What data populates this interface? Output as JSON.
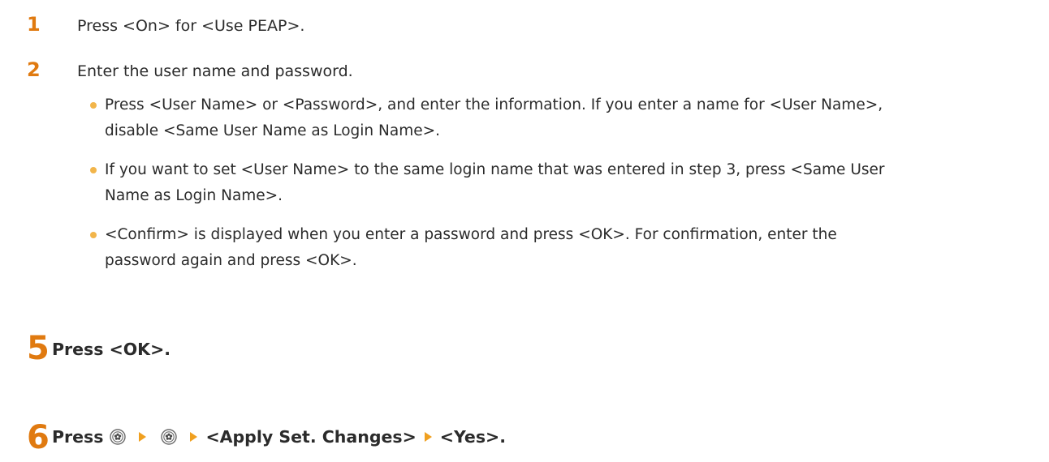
{
  "substeps": [
    {
      "number": "1",
      "text": "Press <On> for <Use PEAP>."
    },
    {
      "number": "2",
      "text": "Enter the user name and password."
    }
  ],
  "bullets": [
    {
      "line1": "Press <User Name> or <Password>, and enter the information. If you enter a name for <User Name>,",
      "line2": "disable <Same User Name as Login Name>."
    },
    {
      "line1": "If you want to set <User Name> to the same login name that was entered in step 3, press <Same User",
      "line2": "Name as Login Name>."
    },
    {
      "line1": "<Confirm> is displayed when you enter a password and press <OK>. For confirmation, enter the",
      "line2": "password again and press <OK>."
    }
  ],
  "step5": {
    "number": "5",
    "text": "Press <OK>."
  },
  "step6": {
    "number": "6",
    "press_label": "Press",
    "key_icon": "settings-key-icon",
    "apply_label": "<Apply Set. Changes>",
    "yes_label": "<Yes>."
  },
  "colors": {
    "accent": "#e07a10",
    "bullet": "#f2b54a",
    "text": "#2b2b2b"
  }
}
